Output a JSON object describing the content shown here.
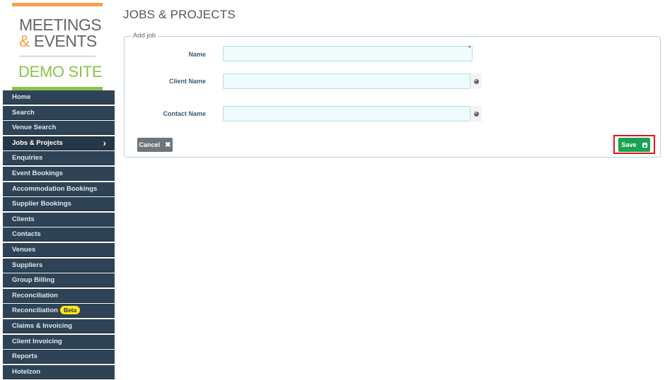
{
  "logo": {
    "line1": "MEETINGS",
    "amp": "&",
    "line2": "EVENTS",
    "subtitle": "DEMO SITE"
  },
  "sidebar": {
    "items": [
      {
        "label": "Home"
      },
      {
        "label": "Search"
      },
      {
        "label": "Venue Search"
      },
      {
        "label": "Jobs & Projects",
        "active": true
      },
      {
        "label": "Enquiries"
      },
      {
        "label": "Event Bookings"
      },
      {
        "label": "Accommodation Bookings"
      },
      {
        "label": "Supplier Bookings"
      },
      {
        "label": "Clients"
      },
      {
        "label": "Contacts"
      },
      {
        "label": "Venues"
      },
      {
        "label": "Suppliers"
      },
      {
        "label": "Group Billing"
      },
      {
        "label": "Reconciliation"
      },
      {
        "label": "Reconciliation",
        "badge": "Beta"
      },
      {
        "label": "Claims & Invoicing"
      },
      {
        "label": "Client Invoicing"
      },
      {
        "label": "Reports"
      },
      {
        "label": "Hotelzon"
      }
    ],
    "active_chevron": "›"
  },
  "header": {
    "title": "JOBS & PROJECTS"
  },
  "form": {
    "legend": "Add job",
    "name_label": "Name",
    "name_value": "",
    "required_marker": "*",
    "client_label": "Client Name",
    "client_value": "",
    "contact_label": "Contact Name",
    "contact_value": "",
    "cancel_label": "Cancel",
    "cancel_icon": "✖",
    "save_label": "Save"
  },
  "colors": {
    "sidebar_bg": "#2e4456",
    "logo_orange": "#f5a04a",
    "logo_green": "#8bc34a",
    "save_green": "#1aa253",
    "highlight_red": "#e0141e",
    "input_bg": "#eefcfd"
  },
  "icons": {
    "lookup": "globe-icon",
    "save": "floppy-disk-icon",
    "cancel": "close-icon",
    "nav_active": "chevron-right-icon"
  }
}
